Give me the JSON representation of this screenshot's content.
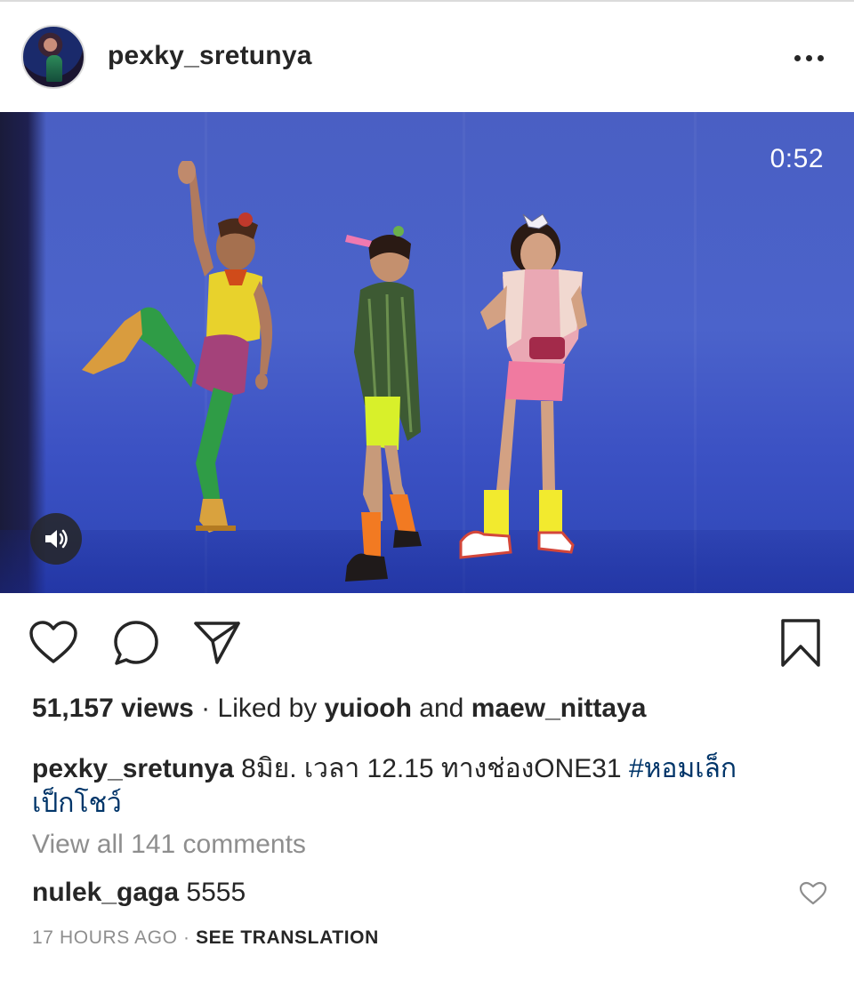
{
  "post": {
    "username": "pexky_sretunya",
    "more_label": "More options"
  },
  "video": {
    "duration": "0:52",
    "muted": false
  },
  "stats": {
    "views": "51,157 views",
    "separator": "·",
    "liked_by_prefix": "Liked by",
    "liked_user_1": "yuiooh",
    "liked_and": "and",
    "liked_user_2": "maew_nittaya"
  },
  "caption": {
    "username": "pexky_sretunya",
    "text": "8มิย. เวลา 12.15 ทางช่องONE31",
    "hashtag_part1": "#หอมเล็ก",
    "hashtag_part2": "เป็กโชว์"
  },
  "comments": {
    "view_all": "View all 141 comments",
    "items": [
      {
        "username": "nulek_gaga",
        "text": "5555"
      }
    ]
  },
  "meta": {
    "time_ago": "17 HOURS AGO",
    "dot": "·",
    "see_translation": "SEE TRANSLATION"
  },
  "icons": {
    "like": "heart-icon",
    "comment": "comment-bubble-icon",
    "share": "paper-plane-icon",
    "save": "bookmark-icon",
    "more": "ellipsis-icon",
    "audio": "speaker-icon"
  },
  "colors": {
    "text": "#262626",
    "secondary": "#8e8e8e",
    "link": "#003569",
    "video_bg": "#4b63cb"
  }
}
